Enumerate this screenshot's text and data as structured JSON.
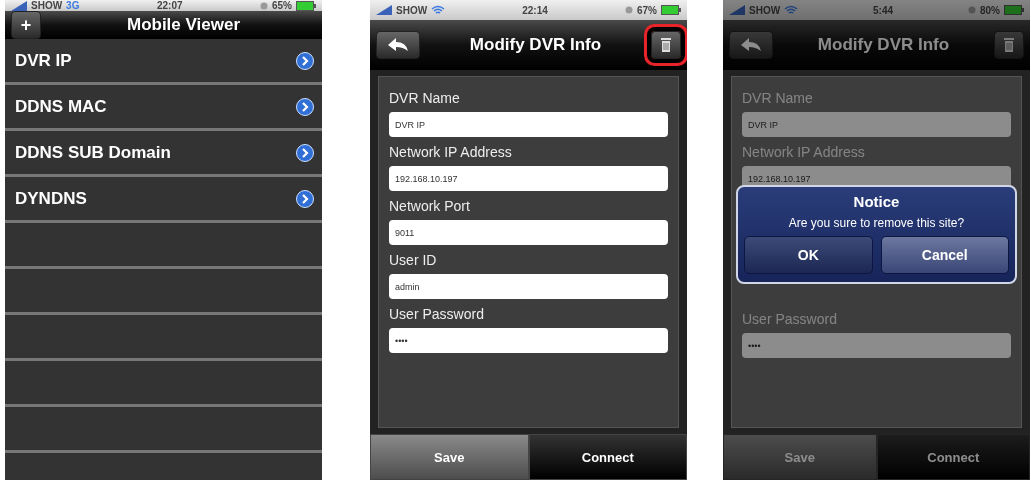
{
  "screens": [
    {
      "kind": "list",
      "status": {
        "carrier": "SHOW",
        "network": "3G",
        "time": "22:07",
        "battery": "65%"
      },
      "nav": {
        "title": "Mobile Viewer",
        "left_button": "+"
      },
      "rows": [
        {
          "label": "DVR IP"
        },
        {
          "label": "DDNS MAC"
        },
        {
          "label": "DDNS SUB Domain"
        },
        {
          "label": "DYNDNS"
        }
      ]
    },
    {
      "kind": "form",
      "dimmed": false,
      "status": {
        "carrier": "SHOW",
        "time": "22:14",
        "battery": "67%"
      },
      "nav": {
        "title": "Modify DVR Info",
        "delete_highlighted": true
      },
      "items": [
        {
          "kind": "field",
          "label": "DVR Name",
          "value": "DVR IP"
        },
        {
          "kind": "field",
          "label": "Network IP Address",
          "value": "192.168.10.197"
        },
        {
          "kind": "field",
          "label": "Network Port",
          "value": "9011"
        },
        {
          "kind": "field",
          "label": "User ID",
          "value": "admin"
        },
        {
          "kind": "field",
          "label": "User Password",
          "value": "••••"
        }
      ],
      "tabs": [
        {
          "label": "Save",
          "selected": false
        },
        {
          "label": "Connect",
          "selected": true
        }
      ]
    },
    {
      "kind": "form",
      "dimmed": true,
      "status": {
        "carrier": "SHOW",
        "time": "5:44",
        "battery": "80%"
      },
      "nav": {
        "title": "Modify DVR Info",
        "delete_highlighted": false
      },
      "items": [
        {
          "kind": "field",
          "label": "DVR Name",
          "value": "DVR IP"
        },
        {
          "kind": "field",
          "label": "Network IP Address",
          "value": "192.168.10.197"
        },
        {
          "kind": "dialog",
          "title": "Notice",
          "message": "Are you sure to remove this site?",
          "buttons": [
            {
              "label": "OK",
              "selected": true
            },
            {
              "label": "Cancel",
              "selected": false
            }
          ]
        },
        {
          "kind": "field",
          "label": "User Password",
          "value": "••••"
        }
      ],
      "tabs": [
        {
          "label": "Save",
          "selected": false
        },
        {
          "label": "Connect",
          "selected": true
        }
      ]
    }
  ]
}
